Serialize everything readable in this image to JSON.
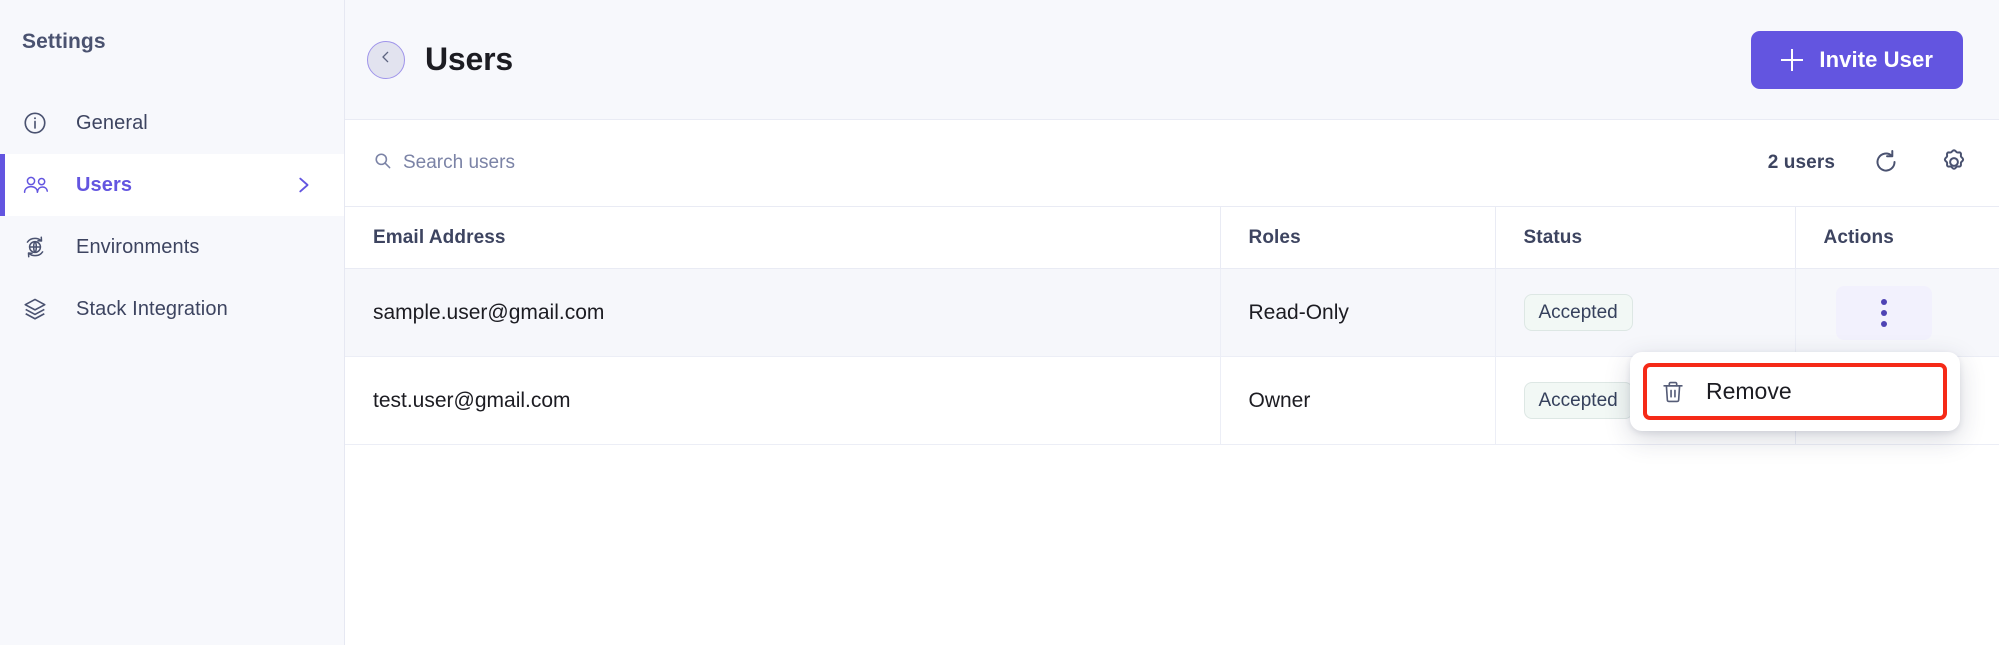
{
  "sidebar": {
    "title": "Settings",
    "items": [
      {
        "label": "General",
        "icon": "info-circle-icon",
        "active": false,
        "chevron": false
      },
      {
        "label": "Users",
        "icon": "users-icon",
        "active": true,
        "chevron": true
      },
      {
        "label": "Environments",
        "icon": "environments-globe-icon",
        "active": false,
        "chevron": false
      },
      {
        "label": "Stack Integration",
        "icon": "layers-icon",
        "active": false,
        "chevron": false
      }
    ]
  },
  "header": {
    "back_icon": "chevron-left-icon",
    "title": "Users",
    "invite_label": "Invite User",
    "invite_icon": "plus-icon"
  },
  "toolbar": {
    "search_placeholder": "Search users",
    "search_value": "",
    "search_icon": "search-icon",
    "user_count": "2 users",
    "refresh_icon": "refresh-icon",
    "settings_icon": "gear-icon"
  },
  "table": {
    "columns": [
      "Email Address",
      "Roles",
      "Status",
      "Actions"
    ],
    "rows": [
      {
        "email": "sample.user@gmail.com",
        "role": "Read-Only",
        "status": "Accepted",
        "actions_icon": "kebab-menu-icon",
        "hovered": true
      },
      {
        "email": "test.user@gmail.com",
        "role": "Owner",
        "status": "Accepted",
        "actions_icon": "kebab-menu-icon",
        "hovered": false
      }
    ]
  },
  "dropdown": {
    "items": [
      {
        "label": "Remove",
        "icon": "trash-icon",
        "highlighted": true
      }
    ]
  },
  "colors": {
    "accent": "#6355e0",
    "sidebar_bg": "#f7f8fc",
    "header_bg": "#f7f8fc",
    "row_hover": "#f6f7fb",
    "badge_bg": "#f2f8f5",
    "highlight_outline": "#f52a17",
    "text_primary": "#1c1c22",
    "text_muted": "#3d4460"
  }
}
